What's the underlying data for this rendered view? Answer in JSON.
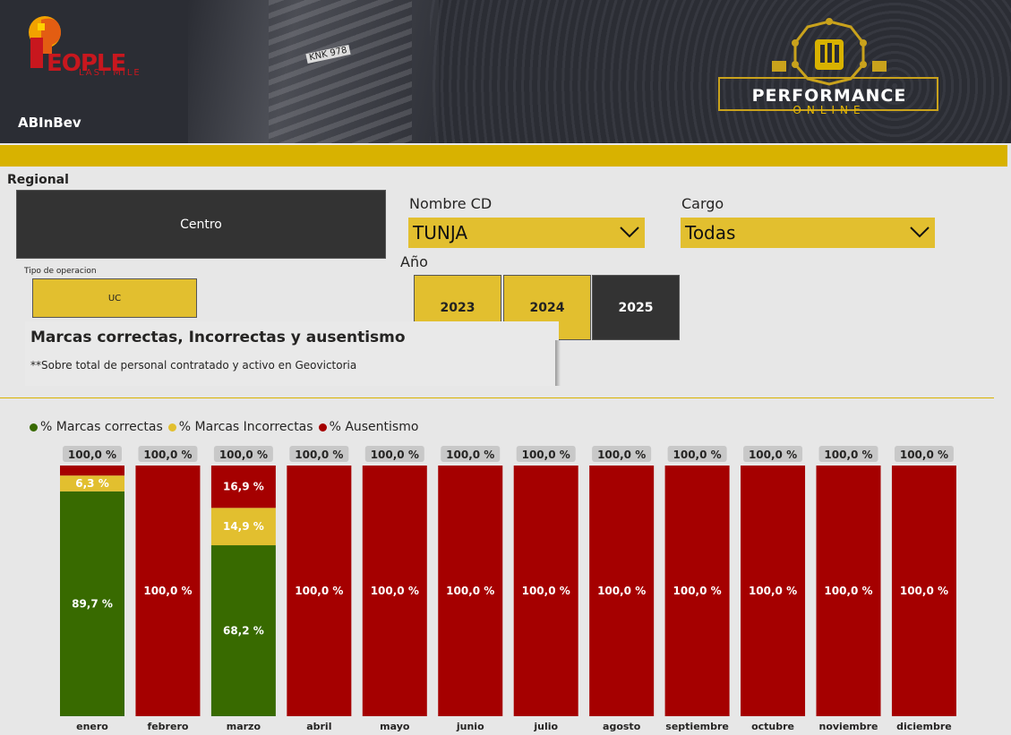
{
  "header": {
    "brand_word": "EOPLE",
    "brand_sub": "LAST MILE",
    "sponsor": "ABInBev",
    "plate": "KNK 978",
    "perf_title": "PERFORMANCE",
    "perf_sub": "ONLINE"
  },
  "filters": {
    "regional_label": "Regional",
    "regional_value": "Centro",
    "tipo_label": "Tipo de operacion",
    "tipo_value": "UC",
    "cd_label": "Nombre CD",
    "cd_value": "TUNJA",
    "cargo_label": "Cargo",
    "cargo_value": "Todas",
    "anio_label": "Año",
    "years": [
      "2023",
      "2024",
      "2025"
    ],
    "selected_year": "2025"
  },
  "card": {
    "title": "Marcas correctas, Incorrectas y ausentismo",
    "subtitle": "**Sobre total de personal contratado y activo en Geovictoria"
  },
  "colors": {
    "correct": "#386a00",
    "incorrect": "#e2bf2f",
    "absent": "#a50000",
    "accent": "#d8b200"
  },
  "chart_data": {
    "type": "bar",
    "stacked": true,
    "legend_position": "top-left",
    "categories": [
      "enero",
      "febrero",
      "marzo",
      "abril",
      "mayo",
      "junio",
      "julio",
      "agosto",
      "septiembre",
      "octubre",
      "noviembre",
      "diciembre"
    ],
    "series": [
      {
        "name": "% Marcas correctas",
        "color": "#386a00",
        "values": [
          89.7,
          0,
          68.2,
          0,
          0,
          0,
          0,
          0,
          0,
          0,
          0,
          0
        ]
      },
      {
        "name": "% Marcas Incorrectas",
        "color": "#e2bf2f",
        "values": [
          6.3,
          0,
          14.9,
          0,
          0,
          0,
          0,
          0,
          0,
          0,
          0,
          0
        ]
      },
      {
        "name": "% Ausentismo",
        "color": "#a50000",
        "values": [
          4.0,
          100.0,
          16.9,
          100.0,
          100.0,
          100.0,
          100.0,
          100.0,
          100.0,
          100.0,
          100.0,
          100.0
        ]
      }
    ],
    "data_labels": {
      "correct": [
        "89,7 %",
        "",
        "68,2 %",
        "",
        "",
        "",
        "",
        "",
        "",
        "",
        "",
        ""
      ],
      "incorrect": [
        "6,3 %",
        "",
        "14,9 %",
        "",
        "",
        "",
        "",
        "",
        "",
        "",
        "",
        ""
      ],
      "absent": [
        "",
        "100,0 %",
        "16,9 %",
        "100,0 %",
        "100,0 %",
        "100,0 %",
        "100,0 %",
        "100,0 %",
        "100,0 %",
        "100,0 %",
        "100,0 %",
        "100,0 %"
      ]
    },
    "totals": [
      "100,0 %",
      "100,0 %",
      "100,0 %",
      "100,0 %",
      "100,0 %",
      "100,0 %",
      "100,0 %",
      "100,0 %",
      "100,0 %",
      "100,0 %",
      "100,0 %",
      "100,0 %"
    ],
    "ylim": [
      0,
      100
    ]
  }
}
